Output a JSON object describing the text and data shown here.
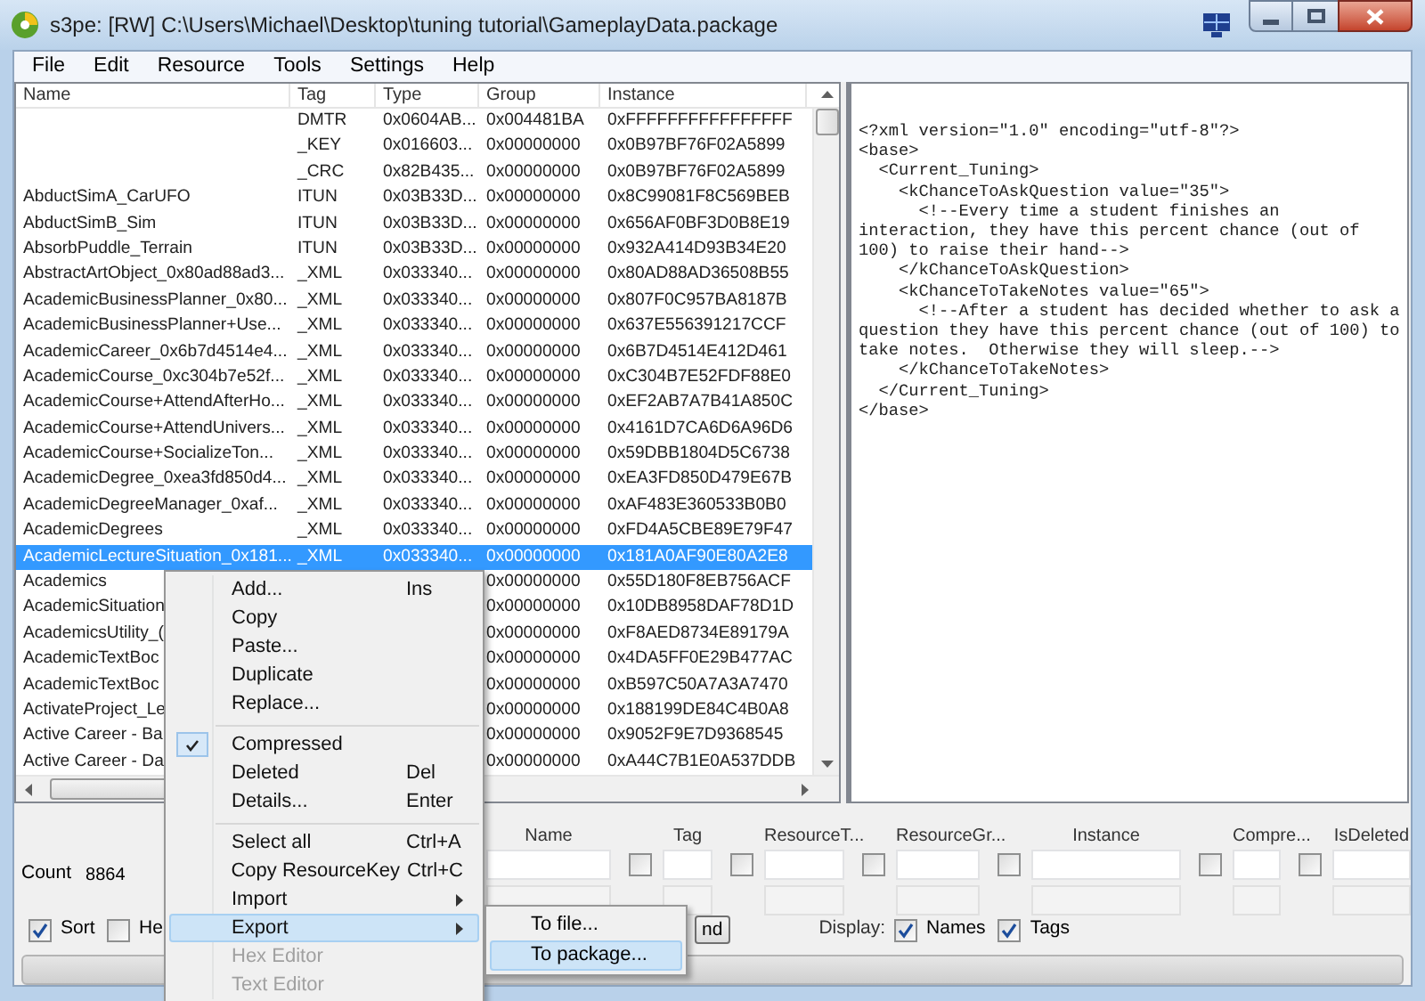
{
  "window": {
    "title": "s3pe: [RW] C:\\Users\\Michael\\Desktop\\tuning tutorial\\GameplayData.package"
  },
  "menu": [
    "File",
    "Edit",
    "Resource",
    "Tools",
    "Settings",
    "Help"
  ],
  "table": {
    "columns": [
      "Name",
      "Tag",
      "Type",
      "Group",
      "Instance"
    ],
    "rows": [
      {
        "name": "",
        "tag": "DMTR",
        "type": "0x0604AB...",
        "group": "0x004481BA",
        "instance": "0xFFFFFFFFFFFFFFFF",
        "selected": false
      },
      {
        "name": "",
        "tag": "_KEY",
        "type": "0x016603...",
        "group": "0x00000000",
        "instance": "0x0B97BF76F02A5899",
        "selected": false
      },
      {
        "name": "",
        "tag": "_CRC",
        "type": "0x82B435...",
        "group": "0x00000000",
        "instance": "0x0B97BF76F02A5899",
        "selected": false
      },
      {
        "name": "AbductSimA_CarUFO",
        "tag": "ITUN",
        "type": "0x03B33D...",
        "group": "0x00000000",
        "instance": "0x8C99081F8C569BEB",
        "selected": false
      },
      {
        "name": "AbductSimB_Sim",
        "tag": "ITUN",
        "type": "0x03B33D...",
        "group": "0x00000000",
        "instance": "0x656AF0BF3D0B8E19",
        "selected": false
      },
      {
        "name": "AbsorbPuddle_Terrain",
        "tag": "ITUN",
        "type": "0x03B33D...",
        "group": "0x00000000",
        "instance": "0x932A414D93B34E20",
        "selected": false
      },
      {
        "name": "AbstractArtObject_0x80ad88ad3...",
        "tag": "_XML",
        "type": "0x033340...",
        "group": "0x00000000",
        "instance": "0x80AD88AD36508B55",
        "selected": false
      },
      {
        "name": "AcademicBusinessPlanner_0x80...",
        "tag": "_XML",
        "type": "0x033340...",
        "group": "0x00000000",
        "instance": "0x807F0C957BA8187B",
        "selected": false
      },
      {
        "name": "AcademicBusinessPlanner+Use...",
        "tag": "_XML",
        "type": "0x033340...",
        "group": "0x00000000",
        "instance": "0x637E556391217CCF",
        "selected": false
      },
      {
        "name": "AcademicCareer_0x6b7d4514e4...",
        "tag": "_XML",
        "type": "0x033340...",
        "group": "0x00000000",
        "instance": "0x6B7D4514E412D461",
        "selected": false
      },
      {
        "name": "AcademicCourse_0xc304b7e52f...",
        "tag": "_XML",
        "type": "0x033340...",
        "group": "0x00000000",
        "instance": "0xC304B7E52FDF88E0",
        "selected": false
      },
      {
        "name": "AcademicCourse+AttendAfterHo...",
        "tag": "_XML",
        "type": "0x033340...",
        "group": "0x00000000",
        "instance": "0xEF2AB7A7B41A850C",
        "selected": false
      },
      {
        "name": "AcademicCourse+AttendUnivers...",
        "tag": "_XML",
        "type": "0x033340...",
        "group": "0x00000000",
        "instance": "0x4161D7CA6D6A96D6",
        "selected": false
      },
      {
        "name": "AcademicCourse+SocializeTon...",
        "tag": "_XML",
        "type": "0x033340...",
        "group": "0x00000000",
        "instance": "0x59DBB1804D5C6738",
        "selected": false
      },
      {
        "name": "AcademicDegree_0xea3fd850d4...",
        "tag": "_XML",
        "type": "0x033340...",
        "group": "0x00000000",
        "instance": "0xEA3FD850D479E67B",
        "selected": false
      },
      {
        "name": "AcademicDegreeManager_0xaf...",
        "tag": "_XML",
        "type": "0x033340...",
        "group": "0x00000000",
        "instance": "0xAF483E360533B0B0",
        "selected": false
      },
      {
        "name": "AcademicDegrees",
        "tag": "_XML",
        "type": "0x033340...",
        "group": "0x00000000",
        "instance": "0xFD4A5CBE89E79F47",
        "selected": false
      },
      {
        "name": "AcademicLectureSituation_0x181...",
        "tag": "_XML",
        "type": "0x033340...",
        "group": "0x00000000",
        "instance": "0x181A0AF90E80A2E8",
        "selected": true
      },
      {
        "name": "Academics",
        "group": "0x00000000",
        "instance": "0x55D180F8EB756ACF",
        "selected": false
      },
      {
        "name": "AcademicSituation",
        "group": "0x00000000",
        "instance": "0x10DB8958DAF78D1D",
        "selected": false
      },
      {
        "name": "AcademicsUtility_(",
        "group": "0x00000000",
        "instance": "0xF8AED8734E89179A",
        "selected": false
      },
      {
        "name": "AcademicTextBoc",
        "group": "0x00000000",
        "instance": "0x4DA5FF0E29B477AC",
        "selected": false
      },
      {
        "name": "AcademicTextBoc",
        "group": "0x00000000",
        "instance": "0xB597C50A7A3A7470",
        "selected": false
      },
      {
        "name": "ActivateProject_Le",
        "group": "0x00000000",
        "instance": "0x188199DE84C4B0A8",
        "selected": false
      },
      {
        "name": "Active Career - Ba",
        "group": "0x00000000",
        "instance": "0x9052F9E7D9368545",
        "selected": false
      },
      {
        "name": "Active Career - Da",
        "group": "0x00000000",
        "instance": "0xA44C7B1E0A537DDB",
        "selected": false
      }
    ]
  },
  "preview": {
    "lines": [
      "<?xml version=\"1.0\" encoding=\"utf-8\"?>",
      "<base>",
      "  <Current_Tuning>",
      "    <kChanceToAskQuestion value=\"35\">",
      "      <!--Every time a student finishes an",
      "interaction, they have this percent chance (out of",
      "100) to raise their hand-->",
      "    </kChanceToAskQuestion>",
      "    <kChanceToTakeNotes value=\"65\">",
      "      <!--After a student has decided whether to ask a",
      "question they have this percent chance (out of 100) to",
      "take notes.  Otherwise they will sleep.-->",
      "    </kChanceToTakeNotes>",
      "  </Current_Tuning>",
      "</base>"
    ]
  },
  "count": {
    "label": "Count",
    "value": "8864"
  },
  "filters": [
    {
      "label": "Name"
    },
    {
      "label": "Tag",
      "checked": false
    },
    {
      "label": "ResourceT...",
      "checked": false
    },
    {
      "label": "ResourceGr...",
      "checked": false
    },
    {
      "label": "Instance",
      "checked": false
    },
    {
      "label": "Compre...",
      "checked": false
    },
    {
      "label": "IsDeleted",
      "checked": false
    }
  ],
  "options": [
    {
      "label": "Sort",
      "checked": true
    },
    {
      "label": "He",
      "checked": false
    }
  ],
  "find_button": "nd",
  "display": {
    "label": "Display:",
    "options": [
      {
        "label": "Names",
        "checked": true
      },
      {
        "label": "Tags",
        "checked": true
      }
    ]
  },
  "context_menu": {
    "items": [
      {
        "kind": "item",
        "label": "Add...",
        "shortcut": "Ins",
        "selected": false,
        "disabled": false
      },
      {
        "kind": "item",
        "label": "Copy",
        "selected": false,
        "disabled": false
      },
      {
        "kind": "item",
        "label": "Paste...",
        "selected": false,
        "disabled": false
      },
      {
        "kind": "item",
        "label": "Duplicate",
        "selected": false,
        "disabled": false
      },
      {
        "kind": "item",
        "label": "Replace...",
        "selected": false,
        "disabled": false
      },
      {
        "kind": "separator"
      },
      {
        "kind": "check",
        "label": "Compressed",
        "checked": true,
        "selected": false,
        "disabled": false
      },
      {
        "kind": "check",
        "label": "Deleted",
        "shortcut": "Del",
        "checked": false,
        "selected": false,
        "disabled": false
      },
      {
        "kind": "item",
        "label": "Details...",
        "shortcut": "Enter",
        "selected": false,
        "disabled": false
      },
      {
        "kind": "separator"
      },
      {
        "kind": "item",
        "label": "Select all",
        "shortcut": "Ctrl+A",
        "selected": false,
        "disabled": false
      },
      {
        "kind": "item",
        "label": "Copy ResourceKey",
        "shortcut": "Ctrl+C",
        "selected": false,
        "disabled": false
      },
      {
        "kind": "submenu",
        "label": "Import",
        "selected": false,
        "disabled": false
      },
      {
        "kind": "submenu",
        "label": "Export",
        "selected": true,
        "disabled": false
      },
      {
        "kind": "item",
        "label": "Hex Editor",
        "selected": false,
        "disabled": true
      },
      {
        "kind": "item",
        "label": "Text Editor",
        "selected": false,
        "disabled": true
      }
    ]
  },
  "submenu": {
    "items": [
      {
        "label": "To file...",
        "selected": false
      },
      {
        "label": "To package...",
        "selected": true
      }
    ]
  }
}
